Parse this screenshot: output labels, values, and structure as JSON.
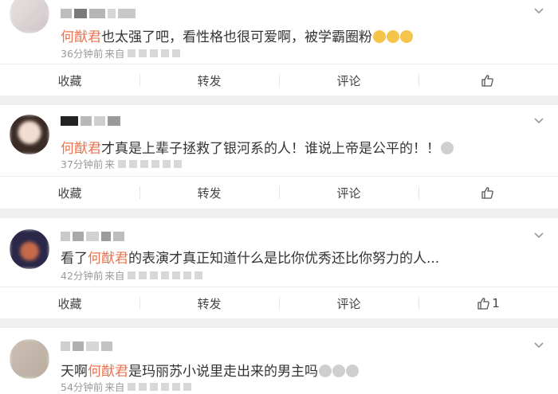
{
  "actions": {
    "collect": "收藏",
    "repost": "转发",
    "comment": "评论"
  },
  "comments": [
    {
      "mention": "何猷君",
      "text_after": "也太强了吧，看性格也很可爱啊，被学霸圈粉",
      "time": "36分钟前",
      "source_prefix": "来自",
      "likes": ""
    },
    {
      "mention": "何猷君",
      "text_after": "才真是上辈子拯救了银河系的人！谁说上帝是公平的！！",
      "time": "37分钟前",
      "source_prefix": "来",
      "likes": ""
    },
    {
      "text_before": "看了",
      "mention": "何猷君",
      "text_after": "的表演才真正知道什么是比你优秀还比你努力的人...",
      "time": "42分钟前",
      "source_prefix": "来自",
      "likes": "1"
    },
    {
      "text_before": "天啊",
      "mention": "何猷君",
      "text_after": "是玛丽苏小说里走出来的男主吗",
      "time": "54分钟前",
      "source_prefix": "来自",
      "likes": ""
    }
  ]
}
